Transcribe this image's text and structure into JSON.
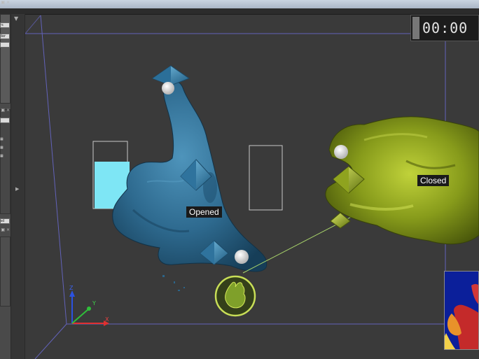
{
  "window": {
    "timer": "00:00"
  },
  "left_panel": {
    "buttons": [
      "ers",
      "ilder",
      "",
      "oad"
    ],
    "ctrl": "▣ ×"
  },
  "labels": {
    "opened": "Opened",
    "closed": "Closed"
  },
  "axes": {
    "x": "X",
    "y": "Y",
    "z": "Z"
  },
  "colors": {
    "viewport_bg": "#3a3a3a",
    "open_hand": "#2f6e92",
    "closed_hand": "#8fa61e",
    "meter_fill": "#7ee6f5",
    "depth_bg": "#0b1f9a"
  },
  "meter": {
    "level": 0.7
  }
}
